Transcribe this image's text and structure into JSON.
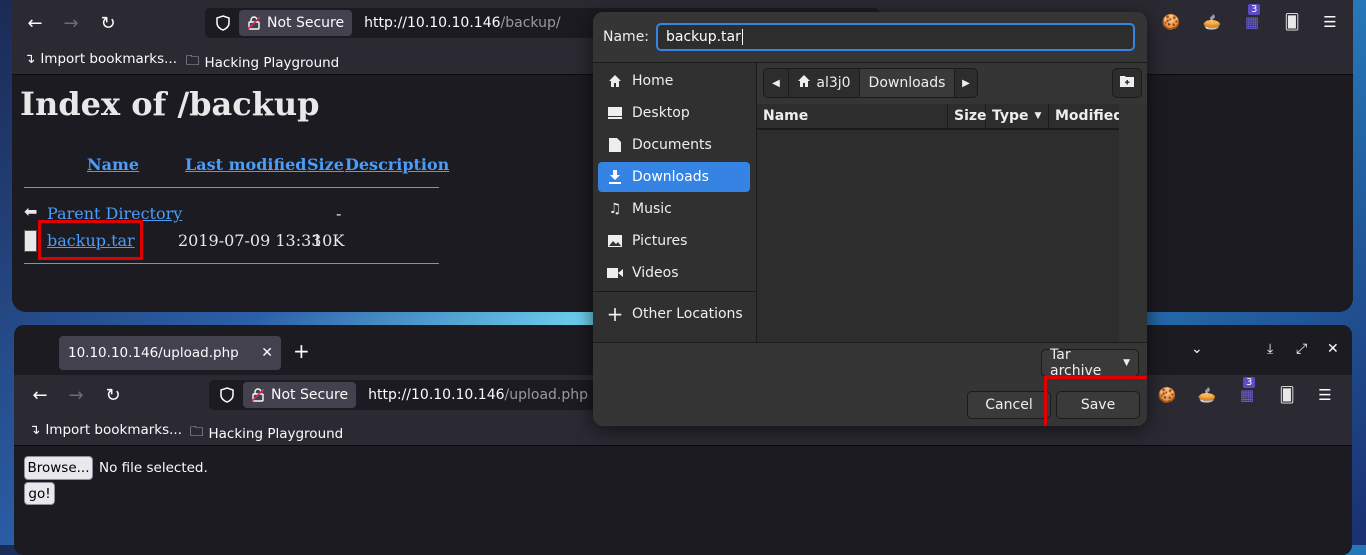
{
  "top_window": {
    "security_label": "Not Secure",
    "url_host": "http://10.10.10.146",
    "url_path": "/backup/",
    "bookmarks": [
      "Import bookmarks...",
      "Hacking Playground"
    ],
    "badge_count": "3",
    "page": {
      "heading": "Index of /backup",
      "columns": [
        "Name",
        "Last modified",
        "Size",
        "Description"
      ],
      "rows": [
        {
          "name": "Parent Directory",
          "modified": "",
          "size": "-"
        },
        {
          "name": "backup.tar",
          "modified": "2019-07-09 13:33",
          "size": "10K"
        }
      ]
    }
  },
  "bottom_window": {
    "tab_title": "10.10.10.146/upload.php",
    "security_label": "Not Secure",
    "url_host": "http://10.10.10.146",
    "url_path": "/upload.php",
    "bookmarks": [
      "Import bookmarks...",
      "Hacking Playground"
    ],
    "badge_count": "3",
    "browse_label": "Browse...",
    "file_status": "No file selected.",
    "go_label": "go!"
  },
  "dialog": {
    "name_label": "Name:",
    "filename": "backup.tar",
    "places": [
      {
        "label": "Home",
        "icon": "home-icon"
      },
      {
        "label": "Desktop",
        "icon": "desktop-icon"
      },
      {
        "label": "Documents",
        "icon": "documents-icon"
      },
      {
        "label": "Downloads",
        "icon": "download-icon",
        "selected": true
      },
      {
        "label": "Music",
        "icon": "music-icon"
      },
      {
        "label": "Pictures",
        "icon": "pictures-icon"
      },
      {
        "label": "Videos",
        "icon": "videos-icon"
      },
      {
        "label": "Other Locations",
        "icon": "plus-icon"
      }
    ],
    "path": [
      "al3j0",
      "Downloads"
    ],
    "columns": [
      "Name",
      "Size",
      "Type",
      "Modified"
    ],
    "filter": "Tar archive",
    "cancel_label": "Cancel",
    "save_label": "Save",
    "accent": "#3584e4"
  },
  "colors": {
    "highlight_box": "#e00000",
    "link": "#4a9df8"
  }
}
